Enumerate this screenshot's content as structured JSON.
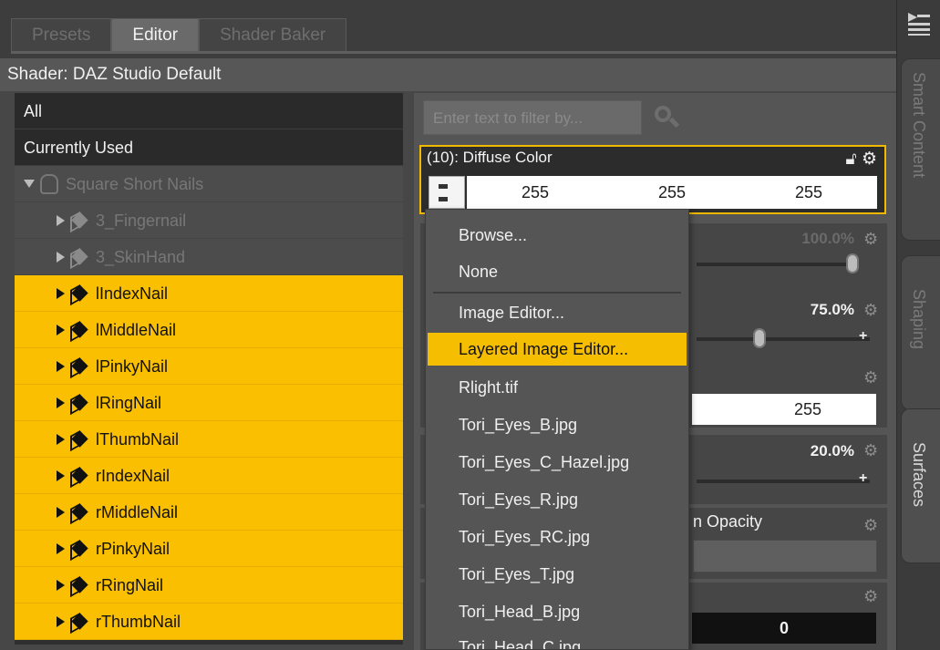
{
  "tabs": [
    {
      "label": "Presets"
    },
    {
      "label": "Editor"
    },
    {
      "label": "Shader Baker"
    }
  ],
  "shader_label": "Shader: DAZ Studio Default",
  "tree": {
    "all_label": "All",
    "currently_used_label": "Currently Used",
    "figure": "Square Short Nails",
    "dim_items": [
      "3_Fingernail",
      "3_SkinHand"
    ],
    "selected_items": [
      "lIndexNail",
      "lMiddleNail",
      "lPinkyNail",
      "lRingNail",
      "lThumbNail",
      "rIndexNail",
      "rMiddleNail",
      "rPinkyNail",
      "rRingNail",
      "rThumbNail"
    ]
  },
  "filter": {
    "placeholder": "Enter text to filter by..."
  },
  "diffuse": {
    "title": "(10): Diffuse Color",
    "r": "255",
    "g": "255",
    "b": "255"
  },
  "properties": {
    "val1": "100.0%",
    "val2": "75.0%",
    "val3": "255",
    "val4": "20.0%",
    "opacity_label": "n Opacity",
    "val5": "0"
  },
  "menu": {
    "items": [
      "Browse...",
      "None",
      "Image Editor...",
      "Layered Image Editor...",
      "Rlight.tif",
      "Tori_Eyes_B.jpg",
      "Tori_Eyes_C_Hazel.jpg",
      "Tori_Eyes_R.jpg",
      "Tori_Eyes_RC.jpg",
      "Tori_Eyes_T.jpg",
      "Tori_Head_B.jpg",
      "Tori_Head_C.jpg"
    ],
    "highlighted": "Layered Image Editor..."
  },
  "side_tabs": [
    "Smart Content",
    "Shaping",
    "Surfaces"
  ],
  "colors": {
    "accent": "#f9bf00"
  }
}
